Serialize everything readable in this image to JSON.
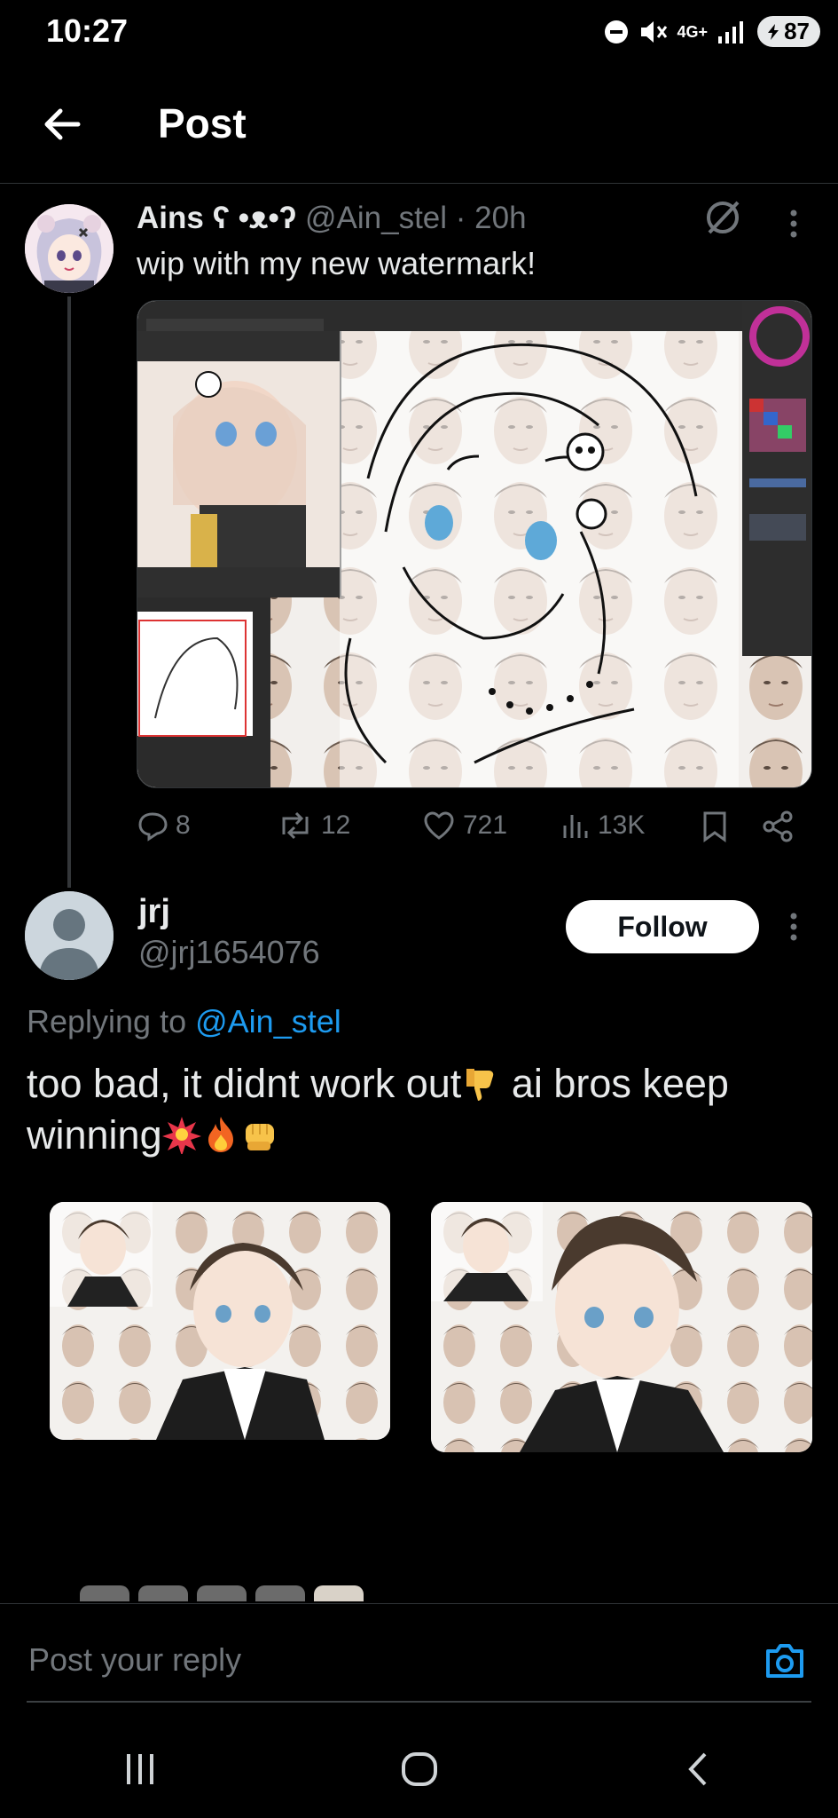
{
  "status_bar": {
    "time": "10:27",
    "network": "4G+",
    "battery": "87"
  },
  "header": {
    "title": "Post",
    "back_icon": "back-arrow-icon"
  },
  "tweet": {
    "display_name": "Ains ʕ •ᴥ•ʔ",
    "handle": "@Ain_stel",
    "time": "· 20h",
    "text": "wip with my new watermark!",
    "stats": {
      "replies": "8",
      "reposts": "12",
      "likes": "721",
      "views": "13K"
    }
  },
  "reply": {
    "display_name": "jrj",
    "handle": "@jrj1654076",
    "follow_label": "Follow",
    "replying_prefix": "Replying to",
    "replying_to": "@Ain_stel",
    "text_part1": "too bad, it didnt work out",
    "text_part2": " ai bros keep winning"
  },
  "composer": {
    "placeholder": "Post your reply"
  },
  "colors": {
    "accent": "#1d9bf0",
    "muted": "#71767b",
    "text": "#e7e9ea",
    "background": "#000000"
  }
}
